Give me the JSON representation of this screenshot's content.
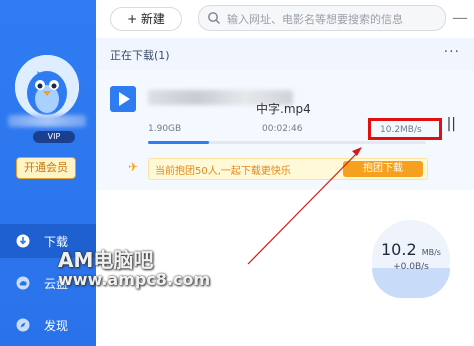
{
  "toolbar": {
    "new_label": "+ 新建",
    "search_placeholder": "输入网址、电影名等想要搜索的信息",
    "minimize": "—"
  },
  "sidebar": {
    "vip_badge": "VIP",
    "open_vip": "开通会员",
    "items": [
      {
        "label": "下载",
        "icon": "download-icon"
      },
      {
        "label": "云盘",
        "icon": "cloud-icon"
      },
      {
        "label": "发现",
        "icon": "compass-icon"
      }
    ]
  },
  "section": {
    "title": "正在下载(1)",
    "more": "···"
  },
  "task": {
    "file_suffix": "中字.mp4",
    "size": "1.90GB",
    "time": "00:02:46",
    "speed": "10.2MB/s",
    "pause": "||",
    "progress_fraction": 0.22
  },
  "promo": {
    "text": "当前抱团50人,一起下载更快乐",
    "button": "抱团下载"
  },
  "gauge": {
    "value": "10.2",
    "unit": "MB/s",
    "sub": "+0.0B/s"
  },
  "watermark": {
    "line1": "AM电脑吧",
    "line2": "www.ampc8.com"
  },
  "colors": {
    "accent": "#2f7cf2",
    "highlight": "#e10f0f",
    "promo": "#f5a01f"
  }
}
